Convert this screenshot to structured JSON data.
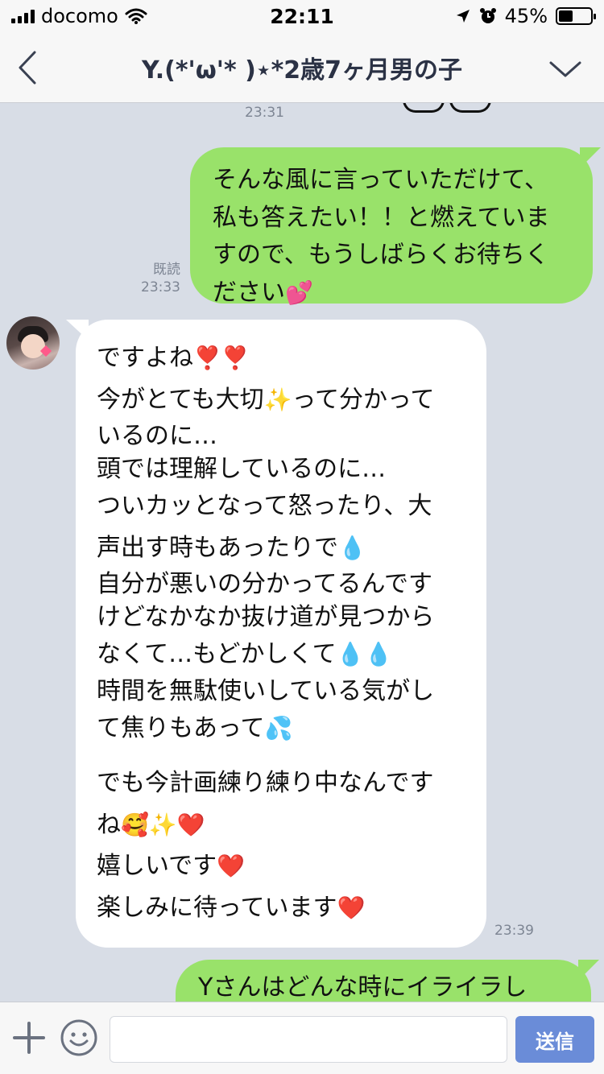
{
  "status_bar": {
    "carrier": "docomo",
    "time": "22:11",
    "battery_percent": "45%",
    "battery_level": 0.45
  },
  "header": {
    "title": "Y.(*'ω'* )⋆*2歳7ヶ月男の子"
  },
  "messages": {
    "m0_time": "23:31",
    "m1": {
      "lines": [
        "そんな風に言っていただけて、",
        "私も答えたい！！と燃えていま",
        "すので、もうしばらくお待ちく",
        "ださい"
      ],
      "emoji": "💕",
      "read": "既読",
      "time": "23:33"
    },
    "m2": {
      "l1": "ですよね",
      "l1_emoji": "❣️❣️",
      "l2a": "今がとても大切",
      "l2_emoji": "✨",
      "l2b": "って分かって",
      "l3": "いるのに…",
      "l4": "頭では理解しているのに…",
      "l5": "ついカッとなって怒ったり、大",
      "l6": "声出す時もあったりで",
      "l6_emoji": "💧",
      "l7": "自分が悪いの分かってるんです",
      "l8": "けどなかなか抜け道が見つから",
      "l9": "なくて…もどかしくて",
      "l9_emoji": "💧💧",
      "l10": "時間を無駄使いしている気がし",
      "l11": "て焦りもあって",
      "l11_emoji": "💦",
      "l12": "でも今計画練り練り中なんです",
      "l13": "ね",
      "l13_emoji": "🥰✨❤️",
      "l14": "嬉しいです",
      "l14_emoji": "❤️",
      "l15": "楽しみに待っています",
      "l15_emoji": "❤️",
      "time": "23:39"
    },
    "m3": {
      "partial": "Yさんはどんな時にイライラし"
    }
  },
  "input_bar": {
    "placeholder": "",
    "send_label": "送信"
  },
  "colors": {
    "outgoing_bubble": "#99e26a",
    "incoming_bubble": "#ffffff",
    "chat_background": "#d8dde6",
    "send_button": "#6a8cd8"
  },
  "icons": [
    "back-chevron-icon",
    "menu-chevron-icon",
    "plus-icon",
    "emoji-icon",
    "wifi-icon",
    "location-icon",
    "alarm-icon",
    "signal-icon"
  ]
}
